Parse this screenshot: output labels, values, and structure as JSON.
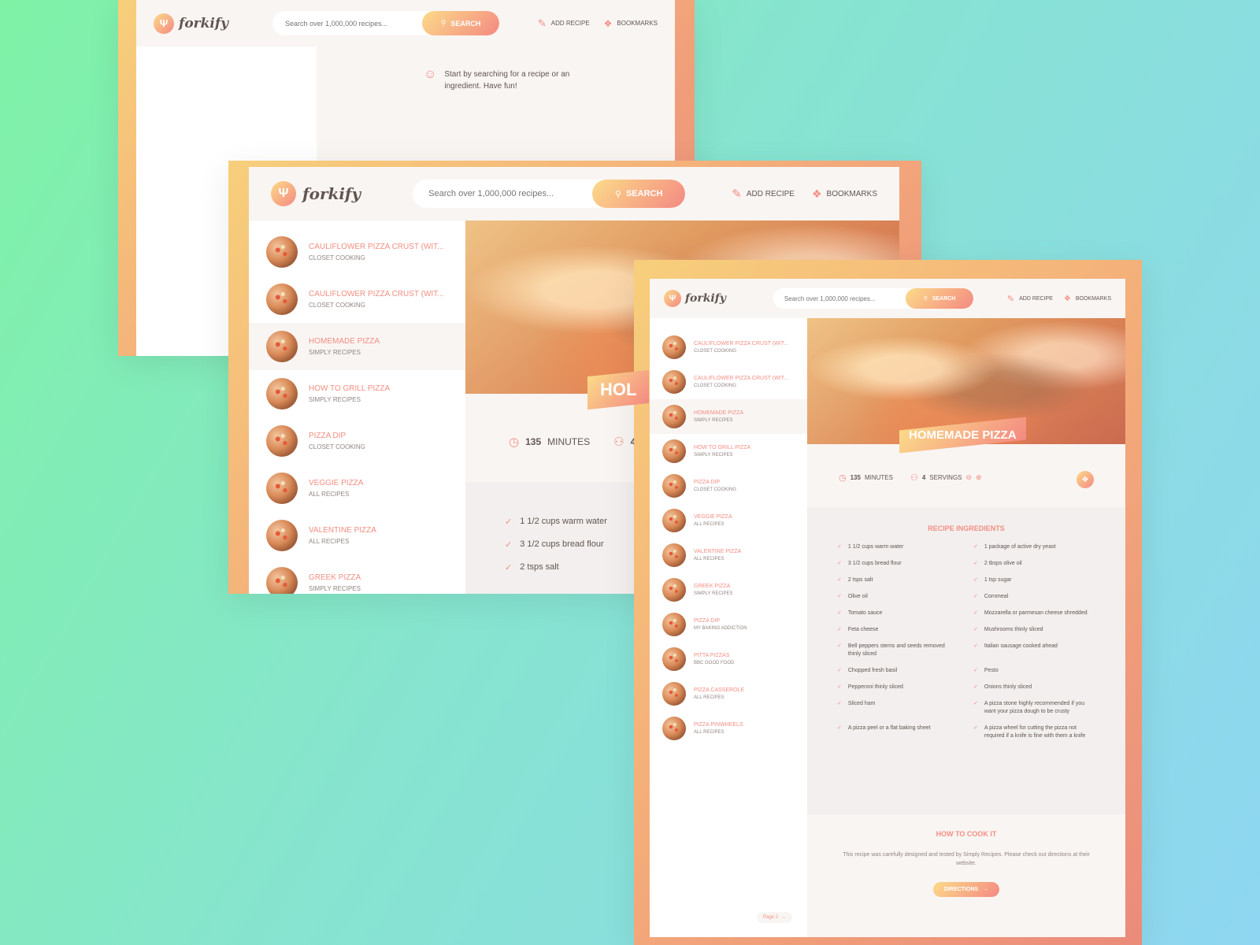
{
  "app": {
    "name": "forkify",
    "search_placeholder": "Search over 1,000,000 recipes...",
    "search_label": "Search",
    "nav_add": "Add recipe",
    "nav_bookmarks": "Bookmarks"
  },
  "empty_state": {
    "message": "Start by searching for a recipe or an ingredient. Have fun!"
  },
  "results": [
    {
      "title": "Cauliflower Pizza Crust (wit...",
      "publisher": "Closet Cooking"
    },
    {
      "title": "Cauliflower Pizza Crust (wit...",
      "publisher": "Closet Cooking"
    },
    {
      "title": "Homemade Pizza",
      "publisher": "Simply Recipes"
    },
    {
      "title": "How to Grill Pizza",
      "publisher": "Simply Recipes"
    },
    {
      "title": "Pizza Dip",
      "publisher": "Closet Cooking"
    },
    {
      "title": "Veggie Pizza",
      "publisher": "All Recipes"
    },
    {
      "title": "Valentine Pizza",
      "publisher": "All Recipes"
    },
    {
      "title": "Greek Pizza",
      "publisher": "Simply Recipes"
    },
    {
      "title": "Pizza Dip",
      "publisher": "My Baking Addiction"
    },
    {
      "title": "Pitta Pizzas",
      "publisher": "BBC Good Food"
    },
    {
      "title": "Pizza Casserole",
      "publisher": "All Recipes"
    },
    {
      "title": "Pizza Pinwheels",
      "publisher": "All Recipes"
    }
  ],
  "recipe": {
    "title": "Homemade Pizza",
    "title_clipped": "Hol",
    "minutes": "135",
    "minutes_label": "minutes",
    "servings": "4",
    "servings_label": "servings",
    "ingredients_heading": "Recipe ingredients",
    "ingredients": [
      "1 1/2 cups warm water",
      "1 package of active dry yeast",
      "3 1/2 cups bread flour",
      "2 tbsps olive oil",
      "2 tsps salt",
      "1 tsp sugar",
      "Olive oil",
      "Cornmeal",
      "Tomato sauce",
      "Mozzarella or parmesan cheese shredded",
      "Feta cheese",
      "Mushrooms thinly sliced",
      "Bell peppers stems and seeds removed thinly sliced",
      "Italian sausage cooked ahead",
      "Chopped fresh basil",
      "Pesto",
      "Pepperoni thinly sliced",
      "Onions thinly sliced",
      "Sliced ham",
      "A pizza stone highly recommended if you want your pizza dough to be crusty",
      "A pizza peel or a flat baking sheet",
      "A pizza wheel for cutting the pizza not required if a knife is fine with them a knife"
    ],
    "mid_ingredients": [
      "1 1/2 cups warm water",
      "3 1/2 cups bread flour",
      "2 tsps salt"
    ],
    "directions_heading": "How to cook it",
    "directions_text": "This recipe was carefully designed and tested by Simply Recipes. Please check out directions at their website.",
    "directions_button": "Directions",
    "page_button": "Page 2"
  }
}
